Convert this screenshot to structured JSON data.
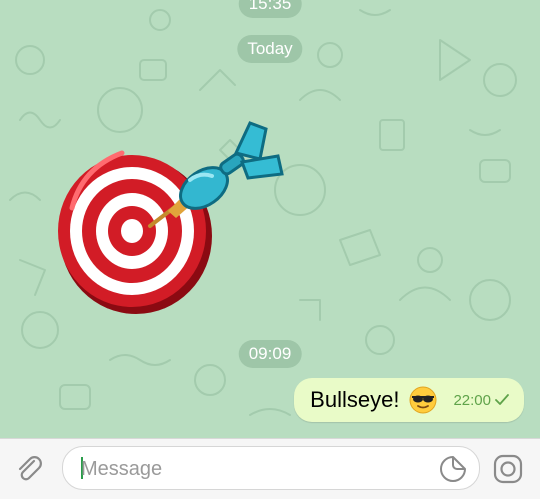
{
  "chat": {
    "date_top_partial": "15:35",
    "date_today": "Today",
    "time_separator": "09:09"
  },
  "message": {
    "text": "Bullseye!",
    "emoji": "smiling-face-with-sunglasses",
    "time": "22:00",
    "status": "sent-check"
  },
  "composer": {
    "placeholder": "Message"
  },
  "icons": {
    "attach": "paperclip-icon",
    "sticker": "sticker-icon",
    "camera": "camera-icon"
  },
  "colors": {
    "chat_background": "#b8ddc0",
    "bubble_out": "#e9fbc8",
    "meta_green": "#5fa34a",
    "caret": "#2a9d4a"
  }
}
